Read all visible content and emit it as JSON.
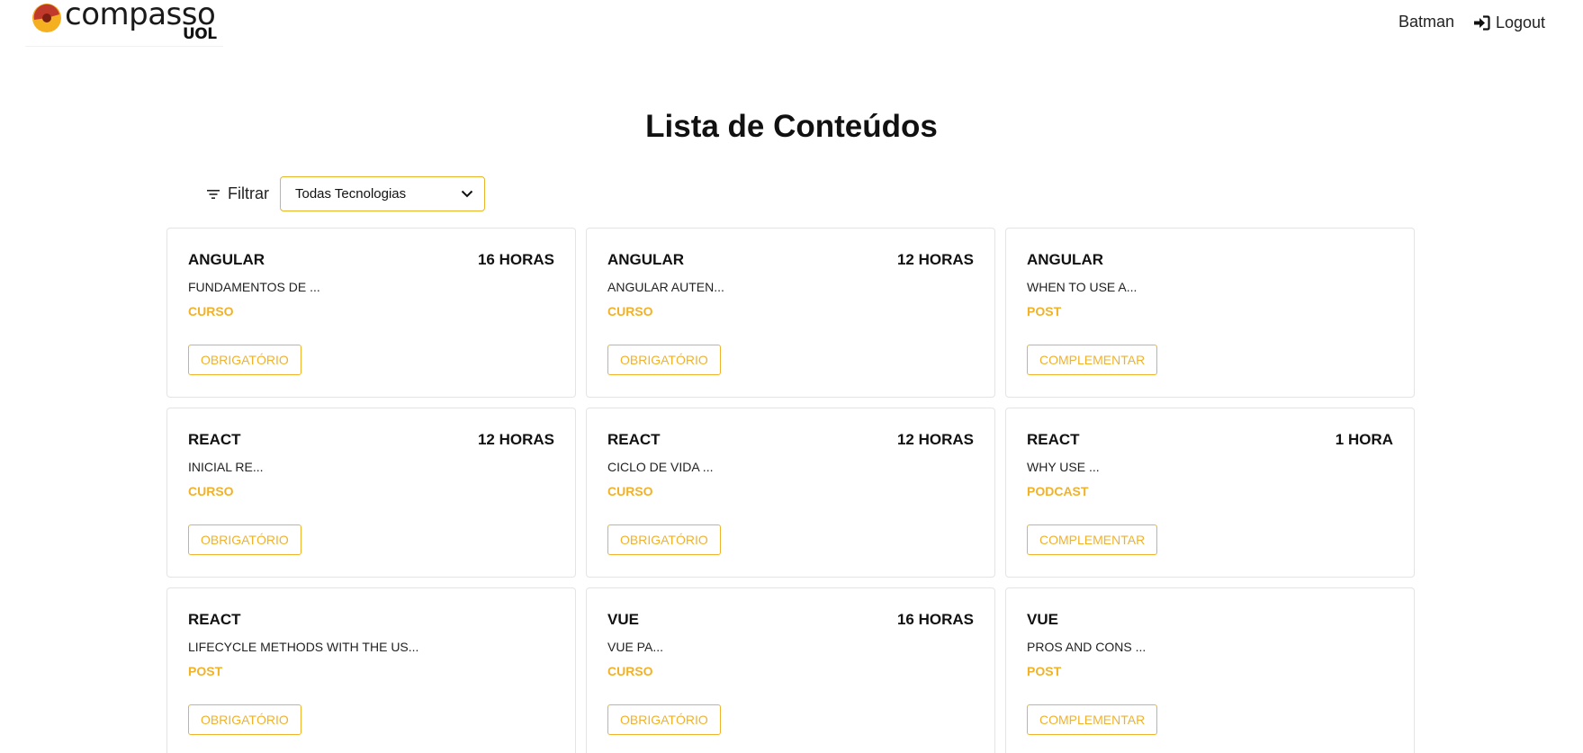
{
  "header": {
    "logo": {
      "name": "compasso",
      "sub": "UOL"
    },
    "user_name": "Batman",
    "logout_label": "Logout"
  },
  "page_title": "Lista de Conteúdos",
  "filter": {
    "label": "Filtrar",
    "selected": "Todas Tecnologias"
  },
  "colors": {
    "accent": "#f0b22a",
    "border": "#e4e4e4",
    "text": "#111111"
  },
  "cards": [
    {
      "tech": "ANGULAR",
      "duration": "16 HORAS",
      "title": "FUNDAMENTOS DE ...",
      "type": "CURSO",
      "badge": "OBRIGATÓRIO"
    },
    {
      "tech": "ANGULAR",
      "duration": "12 HORAS",
      "title": "ANGULAR AUTEN...",
      "type": "CURSO",
      "badge": "OBRIGATÓRIO"
    },
    {
      "tech": "ANGULAR",
      "duration": "",
      "title": "WHEN TO USE A...",
      "type": "POST",
      "badge": "COMPLEMENTAR"
    },
    {
      "tech": "REACT",
      "duration": "12 HORAS",
      "title": "INICIAL RE...",
      "type": "CURSO",
      "badge": "OBRIGATÓRIO"
    },
    {
      "tech": "REACT",
      "duration": "12 HORAS",
      "title": "CICLO DE VIDA ...",
      "type": "CURSO",
      "badge": "OBRIGATÓRIO"
    },
    {
      "tech": "REACT",
      "duration": "1 HORA",
      "title": "WHY USE ...",
      "type": "PODCAST",
      "badge": "COMPLEMENTAR"
    },
    {
      "tech": "REACT",
      "duration": "",
      "title": "LIFECYCLE METHODS WITH THE US...",
      "type": "POST",
      "badge": "OBRIGATÓRIO"
    },
    {
      "tech": "VUE",
      "duration": "16 HORAS",
      "title": "VUE PA...",
      "type": "CURSO",
      "badge": "OBRIGATÓRIO"
    },
    {
      "tech": "VUE",
      "duration": "",
      "title": "PROS AND CONS ...",
      "type": "POST",
      "badge": "COMPLEMENTAR"
    }
  ]
}
